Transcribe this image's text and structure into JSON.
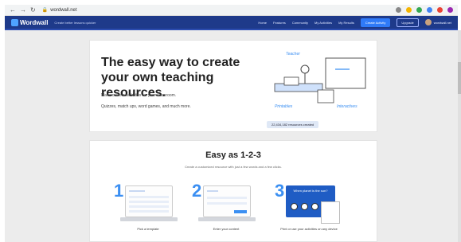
{
  "browser": {
    "url": "wordwall.net",
    "nav_icons": [
      "back-icon",
      "forward-icon",
      "reload-icon"
    ],
    "toolbar_icons": [
      "search-icon",
      "star-icon",
      "extension-icon",
      "shield-icon",
      "puzzle-icon",
      "profile-icon"
    ]
  },
  "header": {
    "logo_text": "Wordwall",
    "tagline": "Create better lessons quicker",
    "nav": [
      "Home",
      "Features",
      "Community",
      "My Activities",
      "My Results"
    ],
    "cta": "Create Activity",
    "upgrade": "Upgrade",
    "account": "wordwall.net"
  },
  "hero": {
    "title": "The easy way to create your own teaching resources.",
    "line1": "Make custom activities for your classroom.",
    "line2": "Quizzes, match ups, word games, and much more.",
    "counter": "22,434,182 resources created",
    "labels": {
      "teacher": "Teacher",
      "printables": "Printables",
      "interactives": "Interactives"
    }
  },
  "easy": {
    "title": "Easy as 1-2-3",
    "caption": "Create a customized resource with just a few words and a few clicks.",
    "steps": [
      {
        "num": "1",
        "label": "Pick a template"
      },
      {
        "num": "2",
        "label": "Enter your content"
      },
      {
        "num": "3",
        "label": "Print or use your activities on any device"
      }
    ],
    "quiz_text": "When planet is the sun?"
  },
  "colors": {
    "header": "#1e3a8a",
    "accent": "#3b8ff2",
    "cta": "#2f7af8",
    "page_bg": "#ececec"
  }
}
